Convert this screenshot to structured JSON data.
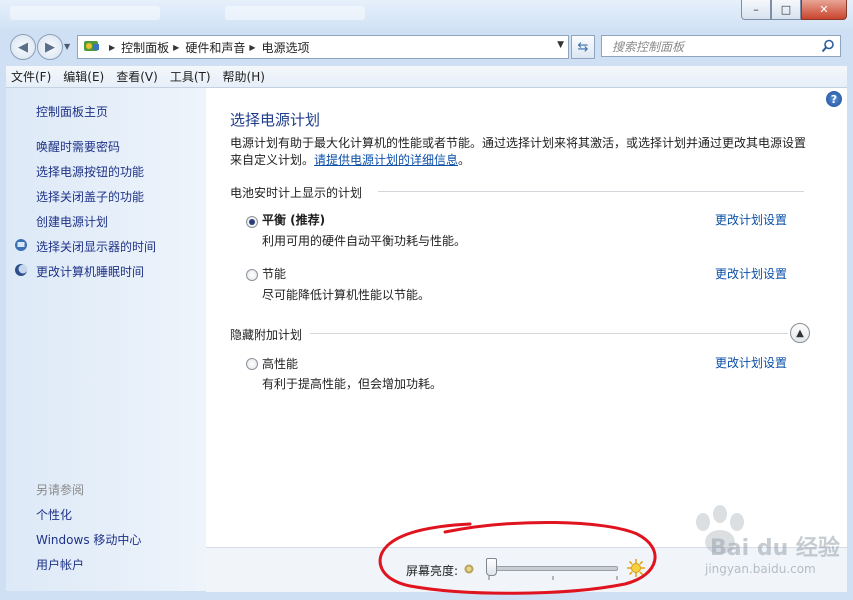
{
  "window": {
    "minimize_glyph": "–",
    "maximize_glyph": "□",
    "close_glyph": "✕"
  },
  "address": {
    "crumbs": [
      "控制面板",
      "硬件和声音",
      "电源选项"
    ],
    "search_placeholder": "搜索控制面板"
  },
  "menu": [
    "文件(F)",
    "编辑(E)",
    "查看(V)",
    "工具(T)",
    "帮助(H)"
  ],
  "sidebar": {
    "home": "控制面板主页",
    "links": [
      "唤醒时需要密码",
      "选择电源按钮的功能",
      "选择关闭盖子的功能",
      "创建电源计划",
      "选择关闭显示器的时间",
      "更改计算机睡眠时间"
    ],
    "see_also_header": "另请参阅",
    "see_also": [
      "个性化",
      "Windows 移动中心",
      "用户帐户"
    ]
  },
  "main": {
    "title": "选择电源计划",
    "desc_text": "电源计划有助于最大化计算机的性能或者节能。通过选择计划来将其激活，或选择计划并通过更改其电源设置来自定义计划。",
    "desc_link": "请提供电源计划的详细信息",
    "desc_end": "。",
    "battery_section": "电池安时计上显示的计划",
    "hidden_section": "隐藏附加计划",
    "plans": [
      {
        "name": "平衡 (推荐)",
        "desc": "利用可用的硬件自动平衡功耗与性能。",
        "selected": true
      },
      {
        "name": "节能",
        "desc": "尽可能降低计算机性能以节能。",
        "selected": false
      },
      {
        "name": "高性能",
        "desc": "有利于提高性能，但会增加功耗。",
        "selected": false
      }
    ],
    "change_link": "更改计划设置"
  },
  "brightness": {
    "label": "屏幕亮度:",
    "level": 0.0
  },
  "watermark": {
    "brand": "Bai du 经验",
    "url": "jingyan.baidu.com"
  },
  "colors": {
    "link": "#0b4fa8",
    "title": "#1e3c8c",
    "annotation": "#e0141e"
  }
}
